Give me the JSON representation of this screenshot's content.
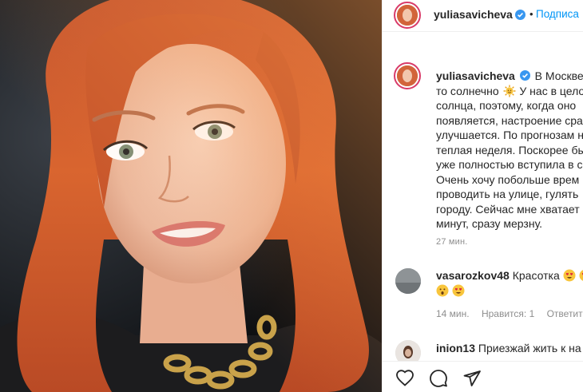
{
  "post": {
    "author": "yuliasavicheva",
    "follow_label": "Подписа",
    "separator": "•"
  },
  "caption": {
    "user": "yuliasavicheva",
    "lines": [
      "В Москве н",
      "то солнечно",
      "У нас в цело",
      "солнца, поэтому, когда оно",
      "появляется, настроение сра",
      "улучшается. По прогнозам н",
      "теплая неделя. Поскорее бы",
      "уже полностью вступила в с",
      "Очень хочу побольше врем",
      "проводить на улице, гулять",
      "городу. Сейчас мне хватает",
      "минут, сразу мерзну."
    ],
    "emoji": "sun-face-emoji",
    "time": "27 мин."
  },
  "comments": [
    {
      "user": "vasarozkov48",
      "text": "Красотка",
      "emojis": [
        "heart-eyes-emoji",
        "heart-eyes-emoji",
        "astonished-emoji",
        "heart-eyes-emoji"
      ],
      "meta": {
        "time": "14 мин.",
        "likes": "Нравится: 1",
        "reply": "Ответит"
      }
    },
    {
      "user": "inion13",
      "text": "Приезжай жить к на"
    }
  ],
  "actions": {
    "like_icon": "heart-icon",
    "comment_icon": "comment-icon",
    "share_icon": "share-icon"
  },
  "colors": {
    "link_blue": "#0095f6",
    "text_primary": "#262626",
    "text_secondary": "#8e8e8e",
    "story_ring": "#d93b69",
    "verified_blue": "#3897f0"
  }
}
